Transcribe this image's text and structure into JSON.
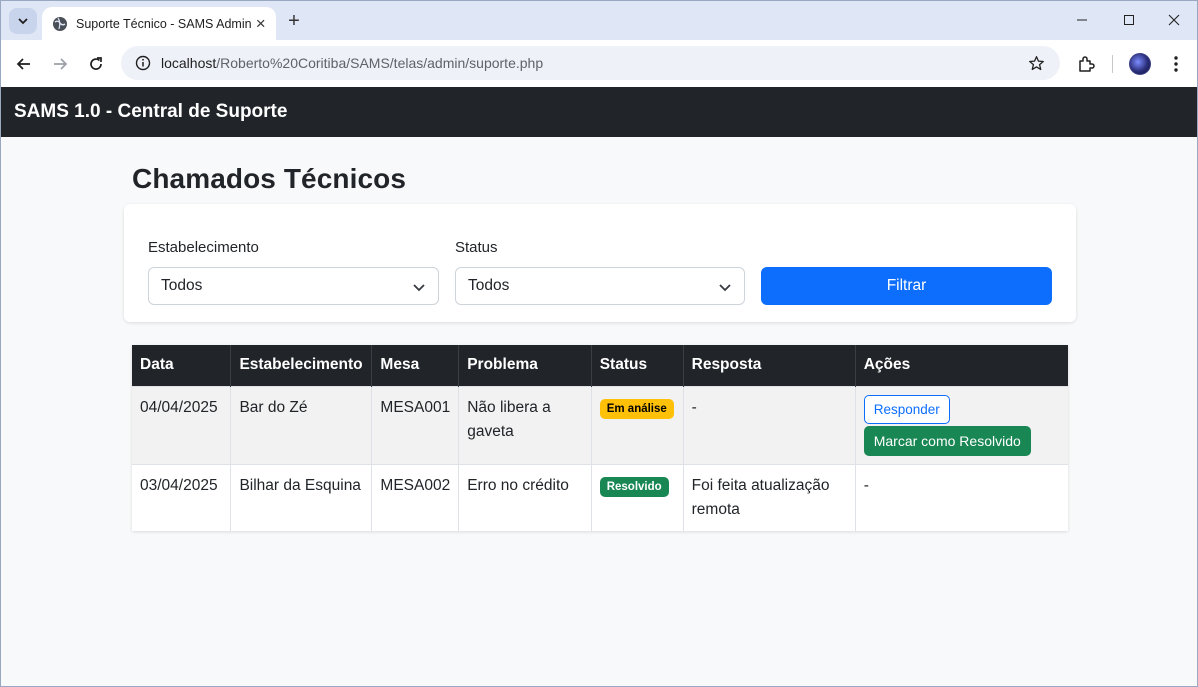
{
  "browser": {
    "tab_title": "Suporte Técnico - SAMS Admin",
    "url_host": "localhost",
    "url_path": "/Roberto%20Coritiba/SAMS/telas/admin/suporte.php"
  },
  "navbar": {
    "brand": "SAMS 1.0 - Central de Suporte"
  },
  "page": {
    "title": "Chamados Técnicos"
  },
  "filters": {
    "establishment_label": "Estabelecimento",
    "establishment_value": "Todos",
    "status_label": "Status",
    "status_value": "Todos",
    "submit_label": "Filtrar"
  },
  "table": {
    "headers": [
      "Data",
      "Estabelecimento",
      "Mesa",
      "Problema",
      "Status",
      "Resposta",
      "Ações"
    ],
    "rows": [
      {
        "data": "04/04/2025",
        "estabelecimento": "Bar do Zé",
        "mesa": "MESA001",
        "problema": "Não libera a gaveta",
        "status": "Em análise",
        "resposta": "-",
        "action_reply": "Responder",
        "action_resolve": "Marcar como Resolvido"
      },
      {
        "data": "03/04/2025",
        "estabelecimento": "Bilhar da Esquina",
        "mesa": "MESA002",
        "problema": "Erro no crédito",
        "status": "Resolvido",
        "resposta": "Foi feita atualização remota",
        "acoes": "-"
      }
    ]
  },
  "colors": {
    "navbar_bg": "#212529",
    "primary": "#0d6efd",
    "success": "#198754",
    "warning": "#ffc107"
  }
}
